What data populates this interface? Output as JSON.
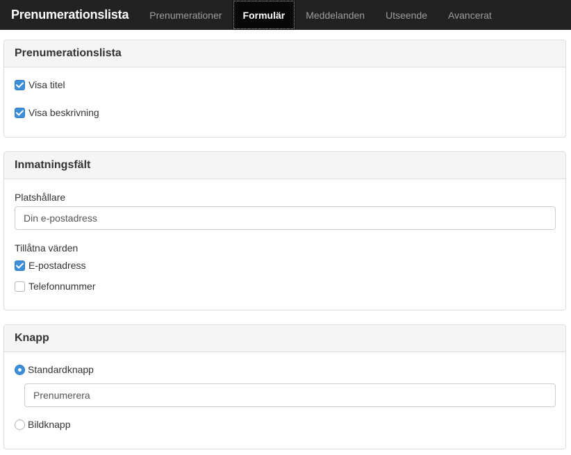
{
  "nav": {
    "brand": "Prenumerationslista",
    "tabs": [
      {
        "label": "Prenumerationer"
      },
      {
        "label": "Formulär",
        "active": true
      },
      {
        "label": "Meddelanden"
      },
      {
        "label": "Utseende"
      },
      {
        "label": "Avancerat"
      }
    ]
  },
  "list_panel": {
    "title": "Prenumerationslista",
    "show_title": {
      "label": "Visa titel",
      "checked": true
    },
    "show_description": {
      "label": "Visa beskrivning",
      "checked": true
    }
  },
  "input_panel": {
    "title": "Inmatningsfält",
    "placeholder_label": "Platshållare",
    "placeholder_value": "Din e-postadress",
    "allowed_label": "Tillåtna värden",
    "email": {
      "label": "E-postadress",
      "checked": true
    },
    "phone": {
      "label": "Telefonnummer",
      "checked": false
    }
  },
  "button_panel": {
    "title": "Knapp",
    "standard": {
      "label": "Standardknapp",
      "selected": true
    },
    "button_text": "Prenumerera",
    "image": {
      "label": "Bildknapp",
      "selected": false
    }
  },
  "colors": {
    "navbar": "#222222",
    "accent": "#3d8fd9"
  }
}
